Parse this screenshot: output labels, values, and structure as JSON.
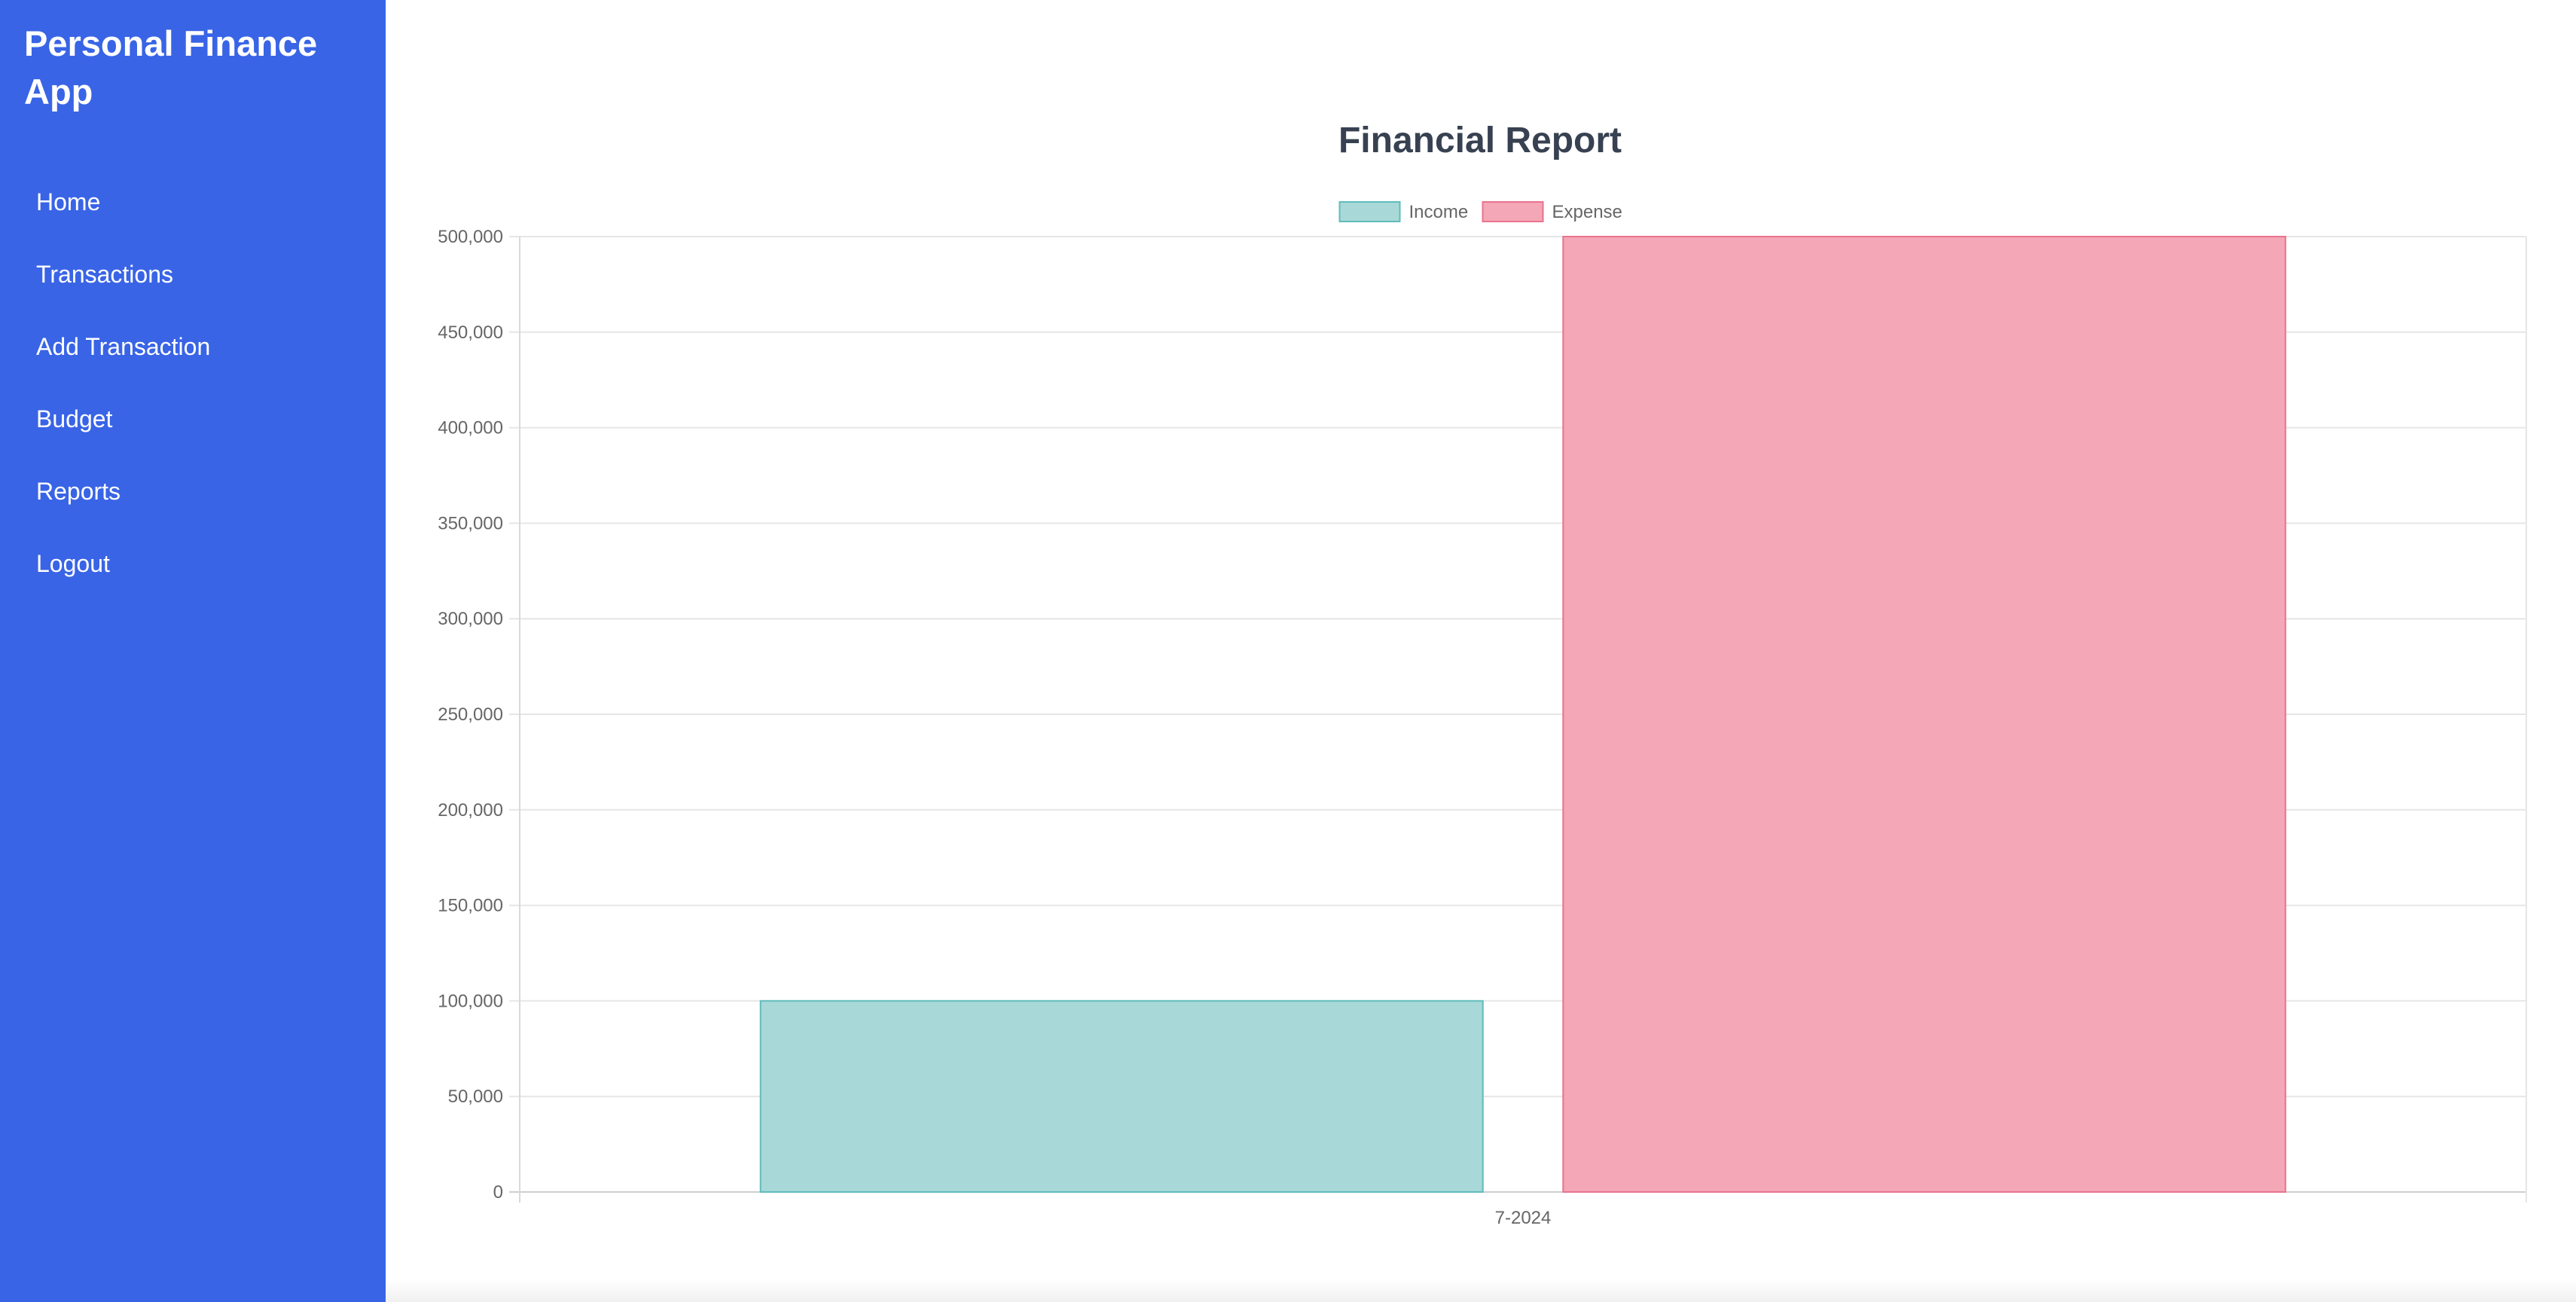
{
  "app": {
    "title": "Personal Finance App"
  },
  "sidebar": {
    "items": [
      {
        "label": "Home",
        "icon": "none"
      },
      {
        "label": "Transactions",
        "icon": "none"
      },
      {
        "label": "Add Transaction",
        "icon": "none"
      },
      {
        "label": "Budget",
        "icon": "none"
      },
      {
        "label": "Reports",
        "icon": "none"
      },
      {
        "label": "Logout",
        "icon": "none"
      }
    ]
  },
  "colors": {
    "sidebar_bg": "#3964e6",
    "income_fill": "#a8d9d8",
    "income_stroke": "#5fbcbc",
    "expense_fill": "#f4a7b6",
    "expense_stroke": "#e9738e",
    "title_color": "#374151"
  },
  "chart_data": {
    "type": "bar",
    "title": "Financial Report",
    "categories": [
      "7-2024"
    ],
    "series": [
      {
        "name": "Income",
        "values": [
          100000
        ]
      },
      {
        "name": "Expense",
        "values": [
          500000
        ]
      }
    ],
    "ylim": [
      0,
      500000
    ],
    "yticks": [
      "0",
      "50,000",
      "100,000",
      "150,000",
      "200,000",
      "250,000",
      "300,000",
      "350,000",
      "400,000",
      "450,000",
      "500,000"
    ],
    "grid": true,
    "legend_position": "top-center"
  }
}
